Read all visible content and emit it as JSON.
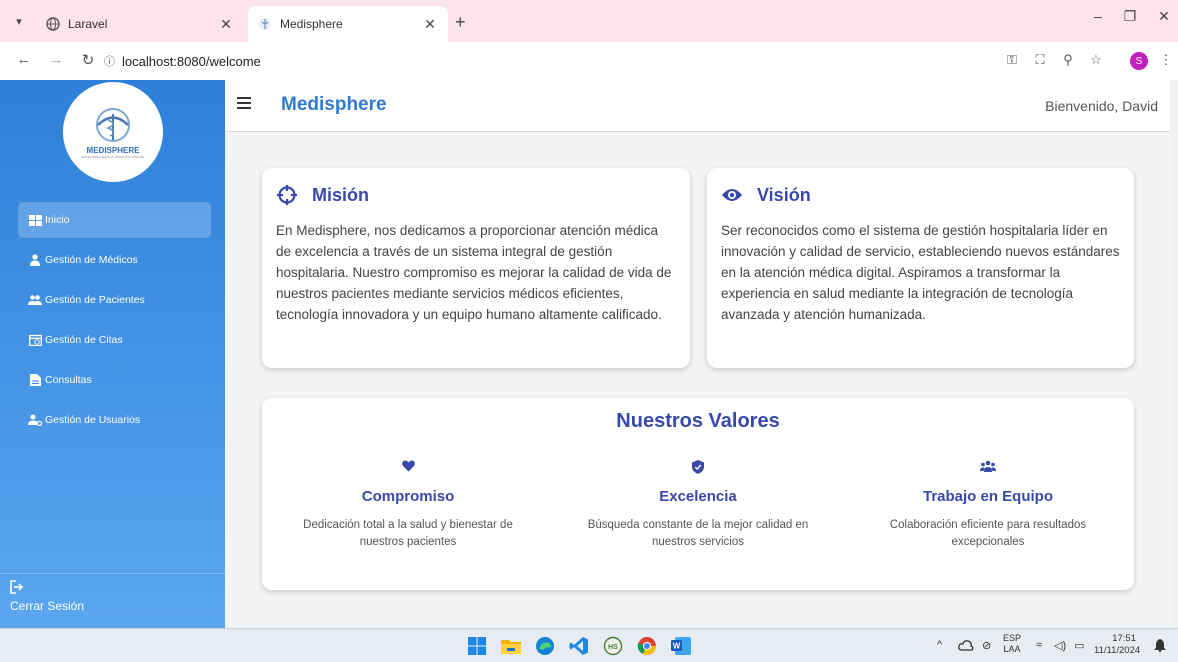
{
  "browser": {
    "tabs": [
      {
        "title": "Laravel",
        "active": false
      },
      {
        "title": "Medisphere",
        "active": true
      }
    ],
    "url": "localhost:8080/welcome",
    "profile_initial": "S"
  },
  "sidebar": {
    "logo_text": "MEDISPHERE",
    "logo_subtext": "EXCELENCIA MÉDICA, ATENCIÓN HUMANA",
    "items": [
      {
        "label": "Inicio",
        "icon": "grid-icon",
        "active": true
      },
      {
        "label": "Gestión de Médicos",
        "icon": "doctor-icon",
        "active": false
      },
      {
        "label": "Gestión de Pacientes",
        "icon": "users-icon",
        "active": false
      },
      {
        "label": "Gestión de Citas",
        "icon": "calendar-icon",
        "active": false
      },
      {
        "label": "Consultas",
        "icon": "file-icon",
        "active": false
      },
      {
        "label": "Gestión de Usuarios",
        "icon": "user-cog-icon",
        "active": false
      }
    ],
    "logout_label": "Cerrar Sesión"
  },
  "header": {
    "brand": "Medisphere",
    "welcome": "Bienvenido, David"
  },
  "mission": {
    "title": "Misión",
    "text": "En Medisphere, nos dedicamos a proporcionar atención médica de excelencia a través de un sistema integral de gestión hospitalaria. Nuestro compromiso es mejorar la calidad de vida de nuestros pacientes mediante servicios médicos eficientes, tecnología innovadora y un equipo humano altamente calificado."
  },
  "vision": {
    "title": "Visión",
    "text": "Ser reconocidos como el sistema de gestión hospitalaria líder en innovación y calidad de servicio, estableciendo nuevos estándares en la atención médica digital. Aspiramos a transformar la experiencia en salud mediante la integración de tecnología avanzada y atención humanizada."
  },
  "values": {
    "title": "Nuestros Valores",
    "items": [
      {
        "icon": "heart-icon",
        "title": "Compromiso",
        "text": "Dedicación total a la salud y bienestar de nuestros pacientes"
      },
      {
        "icon": "shield-icon",
        "title": "Excelencia",
        "text": "Búsqueda constante de la mejor calidad en nuestros servicios"
      },
      {
        "icon": "team-icon",
        "title": "Trabajo en Equipo",
        "text": "Colaboración eficiente para resultados excepcionales"
      }
    ]
  },
  "taskbar": {
    "lang": "ESP",
    "lang_sub": "LAA",
    "time": "17:51",
    "date": "11/11/2024"
  },
  "colors": {
    "accent": "#3949ab",
    "brand": "#2f7ad0",
    "sidebar_top": "#2d7fd9",
    "sidebar_bottom": "#5ba6ef"
  }
}
